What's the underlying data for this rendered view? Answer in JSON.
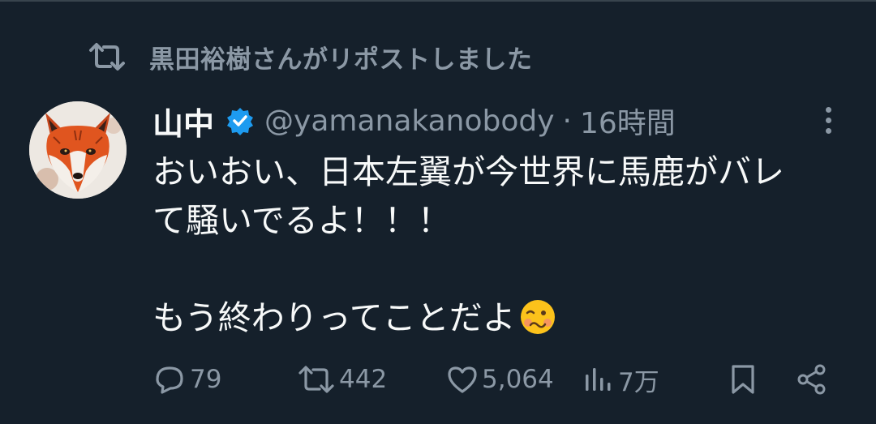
{
  "repost": {
    "icon": "repost-icon",
    "text": "黒田裕樹さんがリポストしました"
  },
  "tweet": {
    "author_name": "山中",
    "verified_icon": "verified-badge-icon",
    "handle": "@yamanakanobody",
    "separator": "·",
    "time": "16時間",
    "text_line1": "おいおい、日本左翼が今世界に馬鹿がバレ",
    "text_line2": "て騒いでるよ！！！",
    "text_line3": "もう終わりってことだよ",
    "emoji": "woozy-face-emoji"
  },
  "actions": {
    "replies": "79",
    "reposts": "442",
    "likes": "5,064",
    "views": "7万"
  },
  "colors": {
    "background": "#15202b",
    "text": "#f7f9f9",
    "muted": "#8b98a5",
    "verified": "#1d9bf0"
  }
}
